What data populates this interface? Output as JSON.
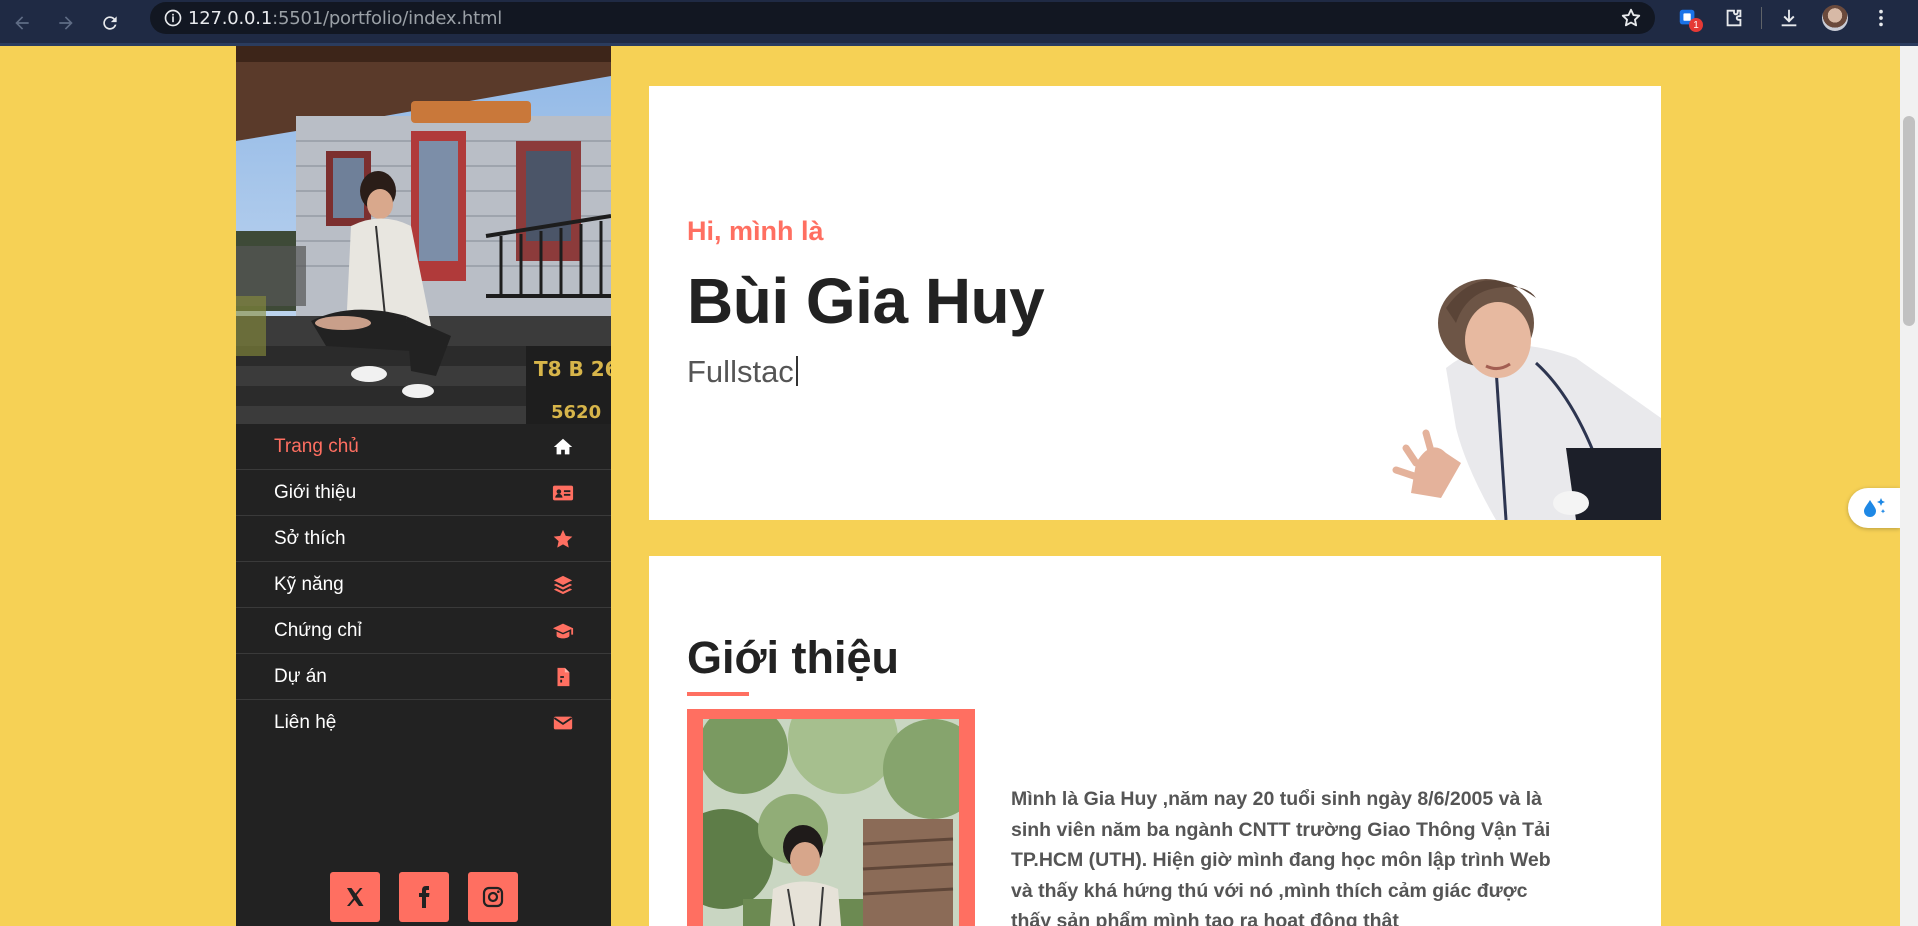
{
  "browser": {
    "url_host": "127.0.0.1",
    "url_rest": ":5501/portfolio/index.html",
    "extension_badge": "1"
  },
  "sidebar": {
    "menu": [
      {
        "label": "Trang chủ",
        "icon": "home-icon",
        "active": true
      },
      {
        "label": "Giới thiệu",
        "icon": "id-card-icon",
        "active": false
      },
      {
        "label": "Sở thích",
        "icon": "star-icon",
        "active": false
      },
      {
        "label": "Kỹ năng",
        "icon": "layers-icon",
        "active": false
      },
      {
        "label": "Chứng chỉ",
        "icon": "graduation-cap-icon",
        "active": false
      },
      {
        "label": "Dự án",
        "icon": "file-icon",
        "active": false
      },
      {
        "label": "Liên hệ",
        "icon": "envelope-icon",
        "active": false
      }
    ],
    "socials": [
      "x-icon",
      "facebook-icon",
      "instagram-icon"
    ]
  },
  "hero": {
    "greeting": "Hi, mình là",
    "name": "Bùi Gia Huy",
    "role": "Fullstac"
  },
  "about": {
    "title": "Giới thiệu",
    "text": "Mình là Gia Huy ,năm nay 20 tuổi sinh ngày 8/6/2005 và là sinh viên năm ba ngành CNTT trường Giao Thông Vận Tải TP.HCM (UTH). Hiện giờ mình đang học môn lập trình Web và thấy khá hứng thú với nó ,mình thích cảm giác được thấy sản phẩm mình tạo ra hoạt động thật"
  },
  "colors": {
    "page_background": "#f6d155",
    "accent": "#ff6f61",
    "sidebar": "#222222",
    "card": "#ffffff"
  }
}
